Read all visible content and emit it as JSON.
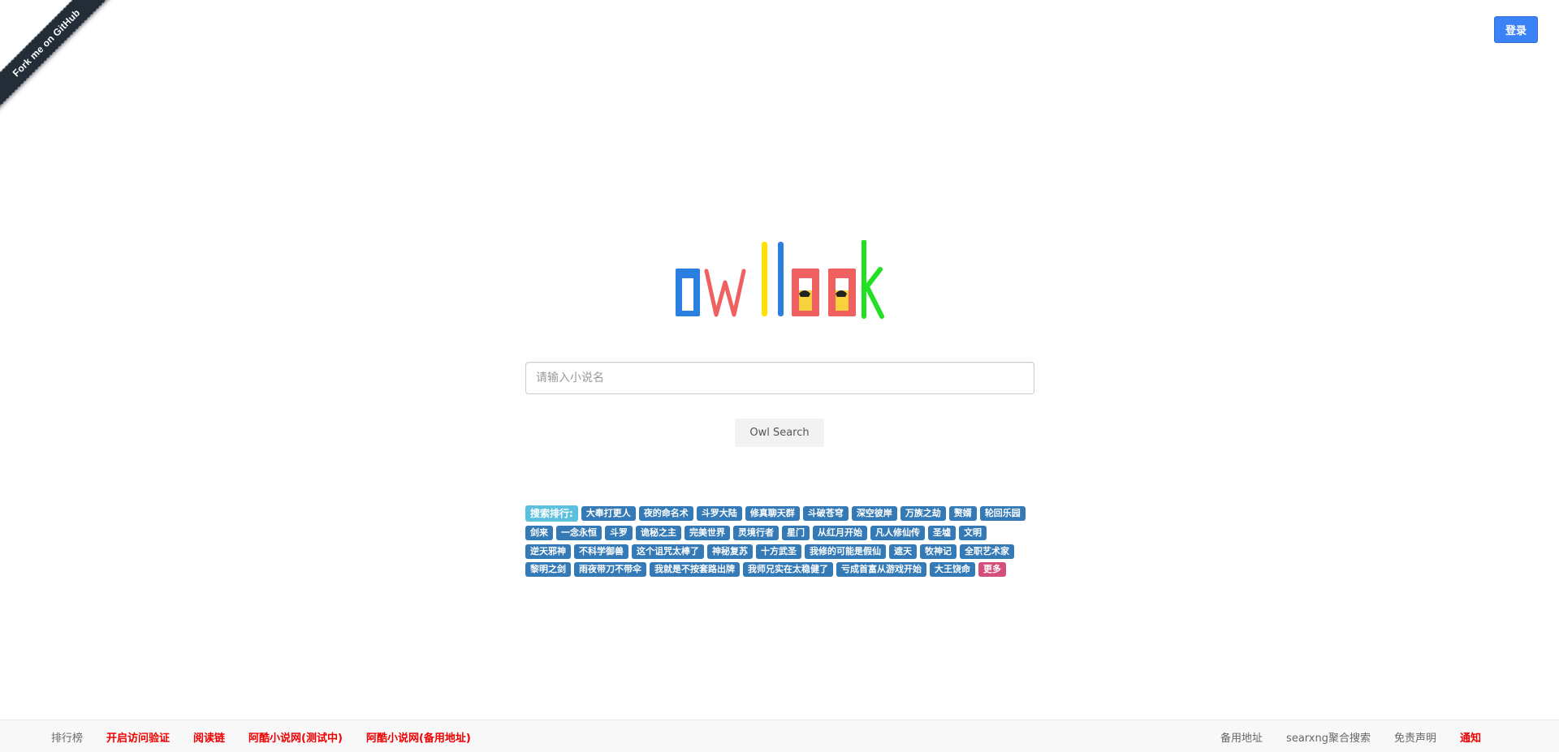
{
  "ribbon": {
    "label": "Fork me on GitHub"
  },
  "header": {
    "login_label": "登录"
  },
  "search": {
    "placeholder": "请输入小说名",
    "button_label": "Owl Search"
  },
  "ranking": {
    "title": "搜索排行:",
    "items": [
      "大奉打更人",
      "夜的命名术",
      "斗罗大陆",
      "修真聊天群",
      "斗破苍穹",
      "深空彼岸",
      "万族之劫",
      "赘婿",
      "轮回乐园",
      "剑来",
      "一念永恒",
      "斗罗",
      "诡秘之主",
      "完美世界",
      "灵境行者",
      "星门",
      "从红月开始",
      "凡人修仙传",
      "圣墟",
      "文明",
      "逆天邪神",
      "不科学御兽",
      "这个诅咒太棒了",
      "神秘复苏",
      "十方武圣",
      "我修的可能是假仙",
      "遮天",
      "牧神记",
      "全职艺术家",
      "黎明之剑",
      "雨夜带刀不带伞",
      "我就是不按套路出牌",
      "我师兄实在太稳健了",
      "亏成首富从游戏开始",
      "大王饶命"
    ],
    "more_label": "更多"
  },
  "footer": {
    "left_links": [
      {
        "label": "排行榜",
        "highlight": false
      },
      {
        "label": "开启访问验证",
        "highlight": true
      },
      {
        "label": "阅读链",
        "highlight": true
      },
      {
        "label": "阿酷小说网(测试中)",
        "highlight": true
      },
      {
        "label": "阿酷小说网(备用地址)",
        "highlight": true
      }
    ],
    "right_links": [
      {
        "label": "备用地址",
        "highlight": false
      },
      {
        "label": "searxng聚合搜索",
        "highlight": false
      },
      {
        "label": "免责声明",
        "highlight": false
      },
      {
        "label": "通知",
        "highlight": true
      }
    ]
  },
  "colors": {
    "login_button": "#3b82f6",
    "tag": "#337ab7",
    "tag_title": "#5bc0de",
    "tag_more": "#d64f7a",
    "footer_highlight": "#ee0000"
  }
}
